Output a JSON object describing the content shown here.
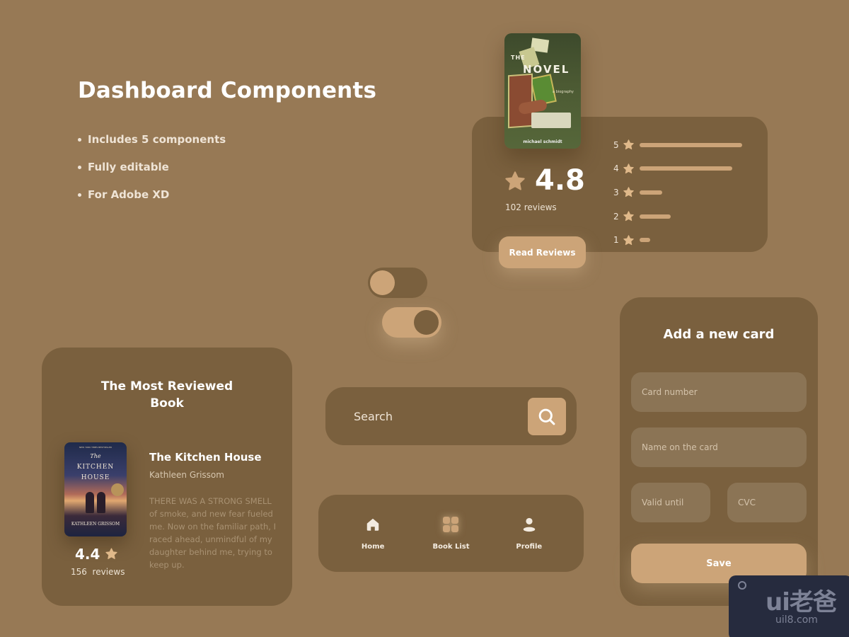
{
  "header": {
    "title": "Dashboard Components",
    "features": [
      "Includes 5 components",
      "Fully editable",
      "For Adobe XD"
    ]
  },
  "colors": {
    "background": "#977955",
    "card": "#7a603e",
    "accent": "#cca478",
    "field": "#8b7455"
  },
  "rating_card": {
    "book": {
      "title_small": "THE",
      "title": "NOVEL",
      "subtitle": "a biography",
      "author": "michael schmidt"
    },
    "rating": "4.8",
    "reviews": "102 reviews",
    "button_label": "Read Reviews",
    "distribution": [
      {
        "stars": "5",
        "fraction": 1.0
      },
      {
        "stars": "4",
        "fraction": 0.9
      },
      {
        "stars": "3",
        "fraction": 0.22
      },
      {
        "stars": "2",
        "fraction": 0.3
      },
      {
        "stars": "1",
        "fraction": 0.1
      }
    ]
  },
  "toggles": [
    {
      "name": "toggle-off",
      "state": "off"
    },
    {
      "name": "toggle-on",
      "state": "on"
    }
  ],
  "most_reviewed": {
    "heading": "The Most Reviewed Book",
    "cover": {
      "top_line": "NEW YORK TIMES BESTSELLER",
      "the": "The",
      "title_line1": "KITCHEN",
      "title_line2": "HOUSE",
      "author": "KATHLEEN GRISSOM"
    },
    "rating": "4.4",
    "reviews": "156  reviews",
    "title": "The Kitchen House",
    "author": "Kathleen Grissom",
    "excerpt": "THERE WAS A STRONG SMELL of smoke, and new fear fueled me. Now on the familiar path, I raced ahead, unmindful of my daughter behind me, trying to keep up."
  },
  "search": {
    "placeholder": "Search",
    "icon": "search-icon"
  },
  "bottom_nav": {
    "items": [
      {
        "label": "Home",
        "icon": "home-icon",
        "active": false
      },
      {
        "label": "Book List",
        "icon": "grid-icon",
        "active": true
      },
      {
        "label": "Profile",
        "icon": "user-icon",
        "active": false
      }
    ]
  },
  "add_card": {
    "title": "Add a new card",
    "card_number_placeholder": "Card number",
    "name_placeholder": "Name on the card",
    "valid_placeholder": "Valid until",
    "cvc_placeholder": "CVC",
    "save_label": "Save"
  },
  "watermark": {
    "logo": "ui老爸",
    "url": "uil8.com"
  }
}
